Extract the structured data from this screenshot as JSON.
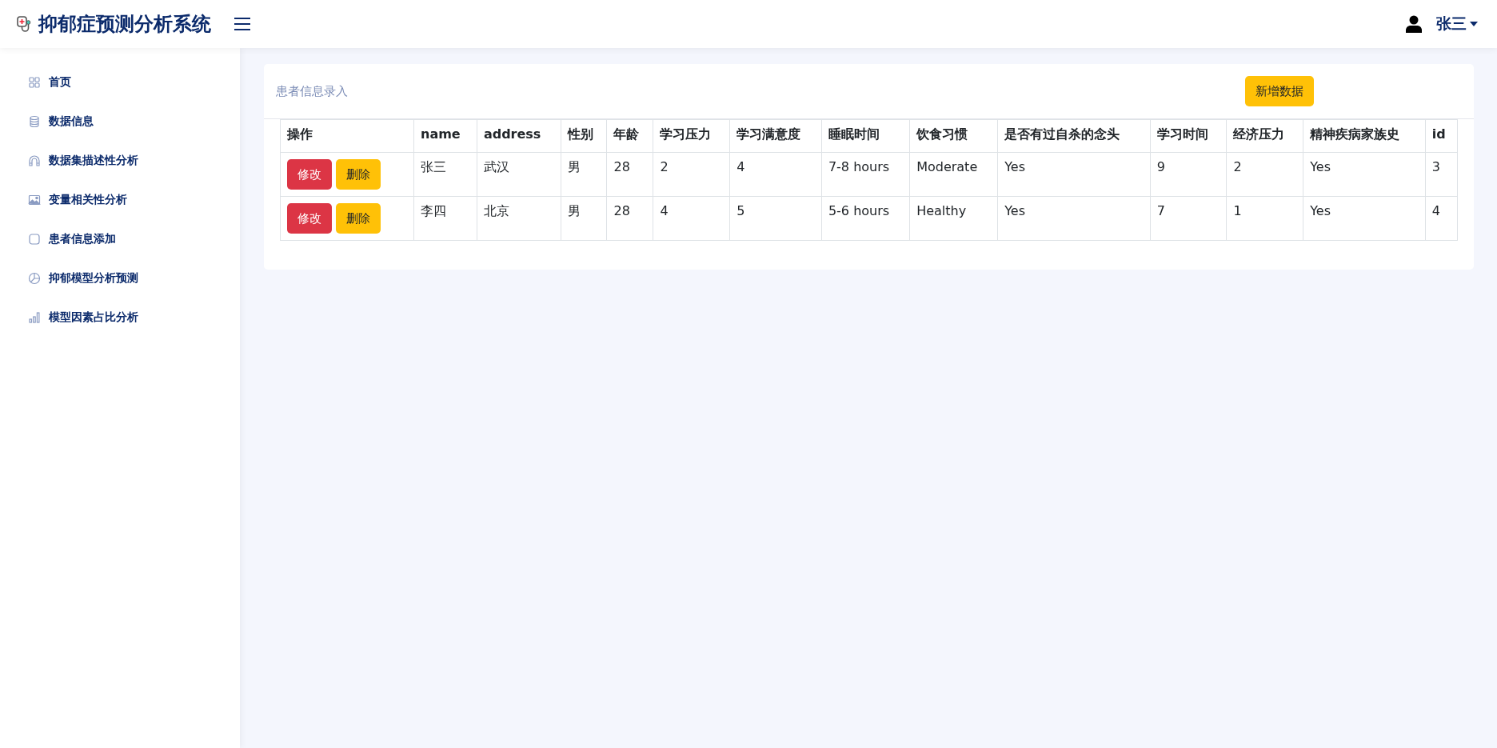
{
  "header": {
    "title": "抑郁症预测分析系统",
    "user": "张三"
  },
  "sidebar": {
    "items": [
      {
        "label": "首页"
      },
      {
        "label": "数据信息"
      },
      {
        "label": "数据集描述性分析"
      },
      {
        "label": "变量相关性分析"
      },
      {
        "label": "患者信息添加"
      },
      {
        "label": "抑郁模型分析预测"
      },
      {
        "label": "模型因素占比分析"
      }
    ]
  },
  "card": {
    "title": "患者信息录入",
    "add_button": "新增数据"
  },
  "table": {
    "columns": [
      "操作",
      "name",
      "address",
      "性别",
      "年龄",
      "学习压力",
      "学习满意度",
      "睡眠时间",
      "饮食习惯",
      "是否有过自杀的念头",
      "学习时间",
      "经济压力",
      "精神疾病家族史",
      "id"
    ],
    "rows": [
      {
        "cells": [
          {
            "kind": "actions",
            "buttons": [
              "修改",
              "删除"
            ]
          },
          "张三",
          "武汉",
          "男",
          "28",
          "2",
          "4",
          "7-8 hours",
          "Moderate",
          "Yes",
          "9",
          "2",
          "Yes",
          "3"
        ]
      },
      {
        "cells": [
          {
            "kind": "actions",
            "buttons": [
              "修改",
              "删除"
            ]
          },
          "李四",
          "北京",
          "男",
          "28",
          "4",
          "5",
          "5-6 hours",
          "Healthy",
          "Yes",
          "7",
          "1",
          "Yes",
          "4"
        ]
      }
    ]
  }
}
